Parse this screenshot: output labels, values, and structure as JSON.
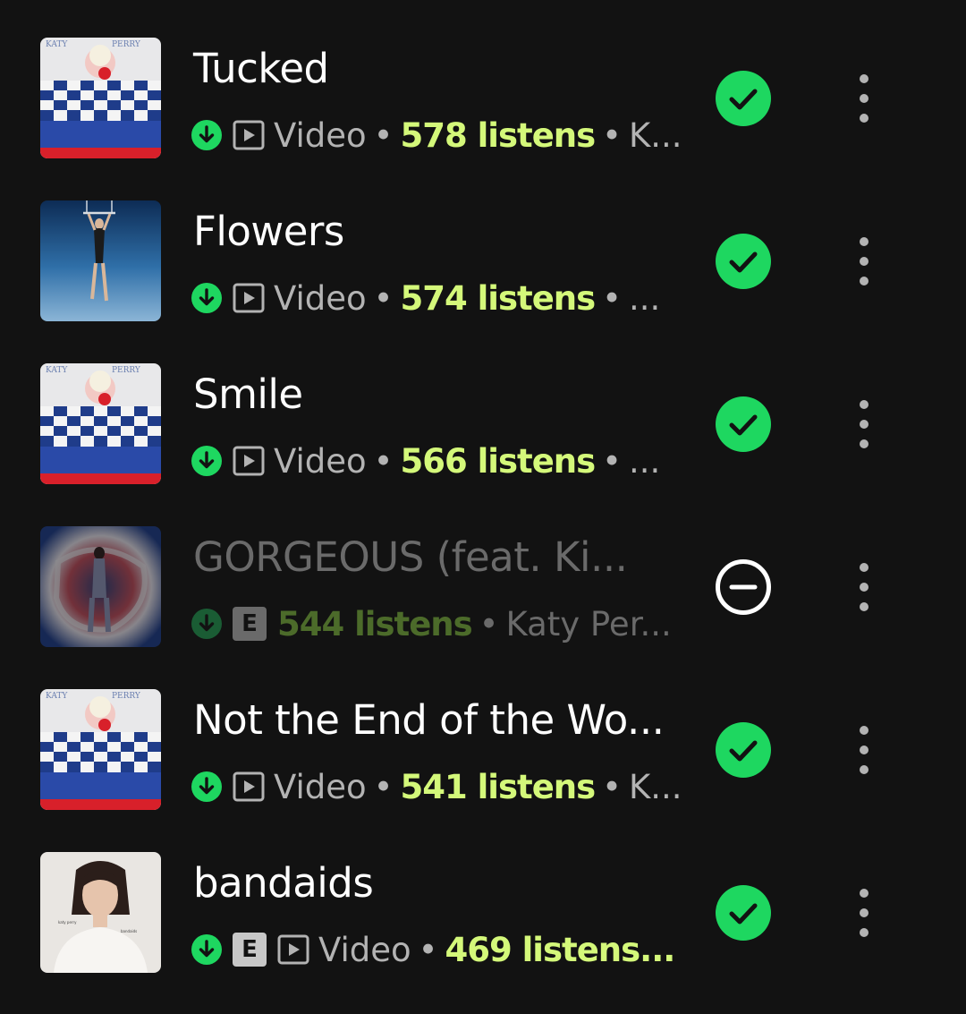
{
  "colors": {
    "background": "#121212",
    "accent_green": "#1ed760",
    "listens_green": "#d4f87a",
    "primary_text": "#ffffff",
    "secondary_text": "#b3b3b3",
    "disabled_text": "#6a6a6a"
  },
  "tracks": [
    {
      "title": "Tucked",
      "explicit_badge": "",
      "video_label": "Video",
      "sep1": "•",
      "listens": "578 listens",
      "sep2": "•",
      "artist": "K...",
      "status": "added",
      "status_icon": "check-circle-icon",
      "art": "smile-album-art"
    },
    {
      "title": "Flowers",
      "explicit_badge": "",
      "video_label": "Video",
      "sep1": "•",
      "listens": "574 listens",
      "sep2": "•",
      "artist": "...",
      "status": "added",
      "status_icon": "check-circle-icon",
      "art": "flowers-album-art"
    },
    {
      "title": "Smile",
      "explicit_badge": "",
      "video_label": "Video",
      "sep1": "•",
      "listens": "566 listens",
      "sep2": "•",
      "artist": "...",
      "status": "added",
      "status_icon": "check-circle-icon",
      "art": "smile-album-art"
    },
    {
      "title": "GORGEOUS (feat. Ki...",
      "explicit_badge": "E",
      "video_label": "",
      "sep1": "",
      "listens": "544 listens",
      "sep2": "•",
      "artist": "Katy Per...",
      "status": "unavailable",
      "status_icon": "minus-circle-icon",
      "art": "gorgeous-album-art"
    },
    {
      "title": "Not the End of the Wo...",
      "explicit_badge": "",
      "video_label": "Video",
      "sep1": "•",
      "listens": "541 listens",
      "sep2": "•",
      "artist": "K...",
      "status": "added",
      "status_icon": "check-circle-icon",
      "art": "smile-album-art"
    },
    {
      "title": "bandaids",
      "explicit_badge": "E",
      "video_label": "Video",
      "sep1": "•",
      "listens": "469 listens...",
      "sep2": "",
      "artist": "",
      "status": "added",
      "status_icon": "check-circle-icon",
      "art": "bandaids-album-art"
    }
  ],
  "art_text": {
    "smile_left": "KATY",
    "smile_right": "PERRY",
    "bandaids_small_left": "katy perry",
    "bandaids_small_right": "bandaids"
  }
}
